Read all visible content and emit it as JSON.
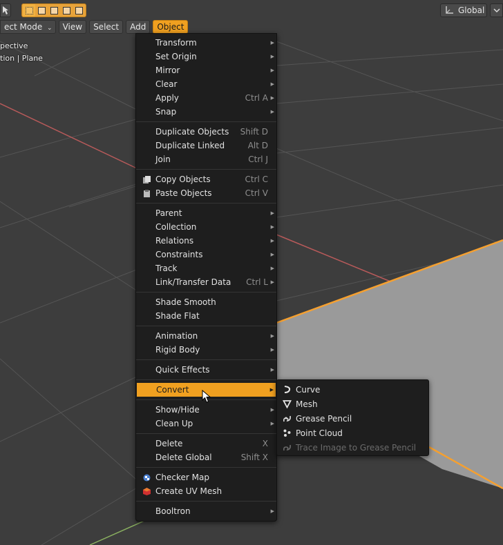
{
  "colors": {
    "viewport_bg": "#3d3d3d",
    "menu_bg": "#1e1e1e",
    "accent": "#f0a020",
    "selection_outline": "#f5a030",
    "x_axis": "#b85a5a",
    "y_axis": "#8ab060"
  },
  "toolbar": {
    "orientation_label": "Global"
  },
  "header": {
    "mode_label": "ect Mode",
    "view_label": "View",
    "select_label": "Select",
    "add_label": "Add",
    "object_label": "Object"
  },
  "viewport_overlay": {
    "line1": "pective",
    "line2": "tion | Plane"
  },
  "object_menu": {
    "groups": [
      [
        {
          "label": "Transform",
          "arrow": true
        },
        {
          "label": "Set Origin",
          "arrow": true
        },
        {
          "label": "Mirror",
          "arrow": true
        },
        {
          "label": "Clear",
          "arrow": true
        },
        {
          "label": "Apply",
          "shortcut": "Ctrl A",
          "arrow": true
        },
        {
          "label": "Snap",
          "arrow": true
        }
      ],
      [
        {
          "label": "Duplicate Objects",
          "shortcut": "Shift D"
        },
        {
          "label": "Duplicate Linked",
          "shortcut": "Alt D"
        },
        {
          "label": "Join",
          "shortcut": "Ctrl J"
        }
      ],
      [
        {
          "label": "Copy Objects",
          "shortcut": "Ctrl C",
          "icon": "copy-icon"
        },
        {
          "label": "Paste Objects",
          "shortcut": "Ctrl V",
          "icon": "paste-icon"
        }
      ],
      [
        {
          "label": "Parent",
          "arrow": true
        },
        {
          "label": "Collection",
          "arrow": true
        },
        {
          "label": "Relations",
          "arrow": true
        },
        {
          "label": "Constraints",
          "arrow": true
        },
        {
          "label": "Track",
          "arrow": true
        },
        {
          "label": "Link/Transfer Data",
          "shortcut": "Ctrl L",
          "arrow": true
        }
      ],
      [
        {
          "label": "Shade Smooth"
        },
        {
          "label": "Shade Flat"
        }
      ],
      [
        {
          "label": "Animation",
          "arrow": true
        },
        {
          "label": "Rigid Body",
          "arrow": true
        }
      ],
      [
        {
          "label": "Quick Effects",
          "arrow": true
        }
      ],
      [
        {
          "label": "Convert",
          "arrow": true,
          "highlight": true
        }
      ],
      [
        {
          "label": "Show/Hide",
          "arrow": true
        },
        {
          "label": "Clean Up",
          "arrow": true
        }
      ],
      [
        {
          "label": "Delete",
          "shortcut": "X"
        },
        {
          "label": "Delete Global",
          "shortcut": "Shift X"
        }
      ],
      [
        {
          "label": "Checker Map",
          "icon": "checker-map-icon"
        },
        {
          "label": "Create UV Mesh",
          "icon": "uv-mesh-icon"
        }
      ],
      [
        {
          "label": "Booltron",
          "arrow": true
        }
      ]
    ]
  },
  "convert_submenu": {
    "items": [
      {
        "label": "Curve",
        "icon": "curve-icon"
      },
      {
        "label": "Mesh",
        "icon": "mesh-icon"
      },
      {
        "label": "Grease Pencil",
        "icon": "grease-pencil-icon"
      },
      {
        "label": "Point Cloud",
        "icon": "point-cloud-icon"
      },
      {
        "label": "Trace Image to Grease Pencil",
        "icon": "trace-image-icon",
        "disabled": true
      }
    ]
  }
}
